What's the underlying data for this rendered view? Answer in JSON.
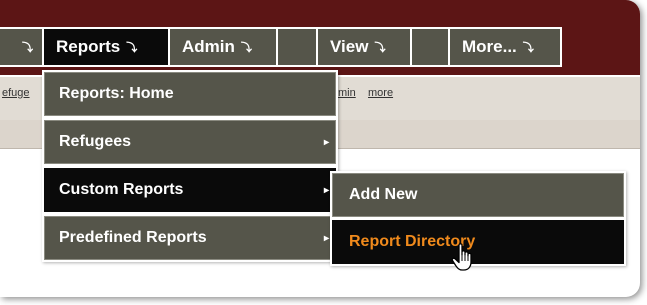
{
  "nav": {
    "items": [
      {
        "label": "",
        "arrow": "⤵"
      },
      {
        "label": "Reports",
        "arrow": "⤵"
      },
      {
        "label": "Admin",
        "arrow": "⤵"
      },
      {
        "label": "",
        "arrow": ""
      },
      {
        "label": "View",
        "arrow": "⤵"
      },
      {
        "label": "",
        "arrow": ""
      },
      {
        "label": "More...",
        "arrow": "⤵"
      }
    ]
  },
  "subbar": {
    "links": [
      "efuge",
      "min",
      "more"
    ]
  },
  "reports_menu": {
    "items": [
      {
        "label": "Reports: Home"
      },
      {
        "label": "Refugees",
        "caret": "▸"
      },
      {
        "label": "Custom Reports",
        "caret": "▸"
      },
      {
        "label": "Predefined Reports",
        "caret": "▸"
      }
    ]
  },
  "custom_reports_submenu": {
    "items": [
      {
        "label": "Add New"
      },
      {
        "label": "Report Directory"
      }
    ]
  },
  "colors": {
    "header": "#5c1515",
    "menu_bg": "#55554a",
    "active_bg": "#0a0a0a",
    "highlight_text": "#f08a1c"
  },
  "icons": {
    "cursor": "hand-pointer-icon"
  }
}
